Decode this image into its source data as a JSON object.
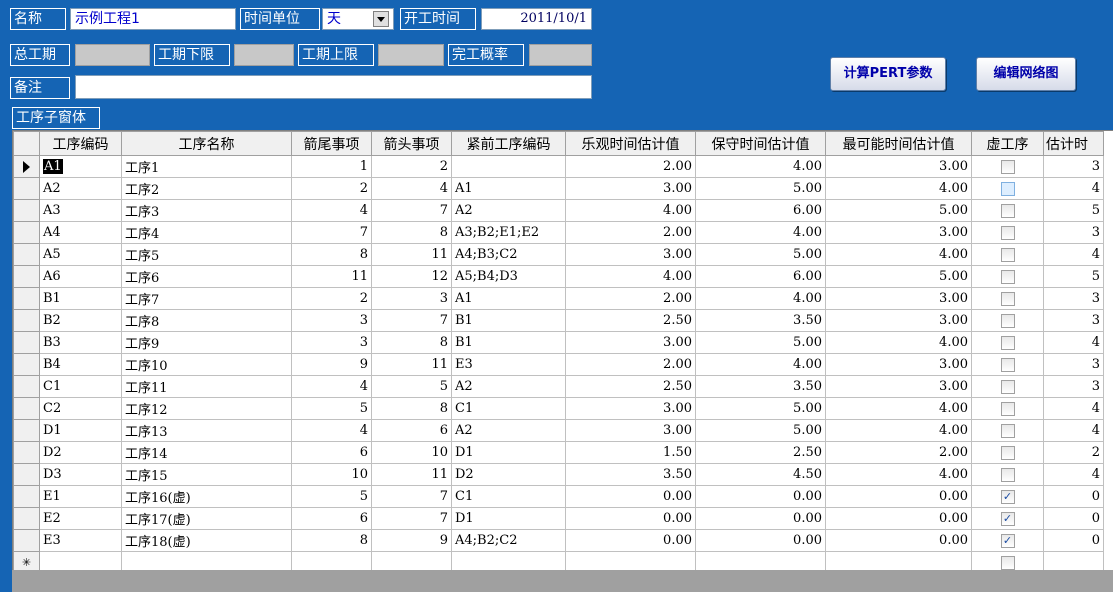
{
  "form": {
    "name_label": "名称",
    "name_value": "示例工程1",
    "time_unit_label": "时间单位",
    "time_unit_value": "天",
    "start_label": "开工时间",
    "start_value": "2011/10/1",
    "total_label": "总工期",
    "lower_label": "工期下限",
    "upper_label": "工期上限",
    "prob_label": "完工概率",
    "note_label": "备注",
    "subform_label": "工序子窗体"
  },
  "buttons": {
    "calc": "计算PERT参数",
    "edit": "编辑网络图"
  },
  "table": {
    "headers": [
      "工序编码",
      "工序名称",
      "箭尾事项",
      "箭头事项",
      "紧前工序编码",
      "乐观时间估计值",
      "保守时间估计值",
      "最可能时间估计值",
      "虚工序",
      "估计时"
    ],
    "new_row_marker": "✳",
    "rows": [
      {
        "code": "A1",
        "name": "工序1",
        "tail": "1",
        "head": "2",
        "pred": "",
        "opt": "2.00",
        "pes": "4.00",
        "likely": "3.00",
        "dummy": false,
        "est": "3"
      },
      {
        "code": "A2",
        "name": "工序2",
        "tail": "2",
        "head": "4",
        "pred": "A1",
        "opt": "3.00",
        "pes": "5.00",
        "likely": "4.00",
        "dummy": false,
        "est": "4"
      },
      {
        "code": "A3",
        "name": "工序3",
        "tail": "4",
        "head": "7",
        "pred": "A2",
        "opt": "4.00",
        "pes": "6.00",
        "likely": "5.00",
        "dummy": false,
        "est": "5"
      },
      {
        "code": "A4",
        "name": "工序4",
        "tail": "7",
        "head": "8",
        "pred": "A3;B2;E1;E2",
        "opt": "2.00",
        "pes": "4.00",
        "likely": "3.00",
        "dummy": false,
        "est": "3"
      },
      {
        "code": "A5",
        "name": "工序5",
        "tail": "8",
        "head": "11",
        "pred": "A4;B3;C2",
        "opt": "3.00",
        "pes": "5.00",
        "likely": "4.00",
        "dummy": false,
        "est": "4"
      },
      {
        "code": "A6",
        "name": "工序6",
        "tail": "11",
        "head": "12",
        "pred": "A5;B4;D3",
        "opt": "4.00",
        "pes": "6.00",
        "likely": "5.00",
        "dummy": false,
        "est": "5"
      },
      {
        "code": "B1",
        "name": "工序7",
        "tail": "2",
        "head": "3",
        "pred": "A1",
        "opt": "2.00",
        "pes": "4.00",
        "likely": "3.00",
        "dummy": false,
        "est": "3"
      },
      {
        "code": "B2",
        "name": "工序8",
        "tail": "3",
        "head": "7",
        "pred": "B1",
        "opt": "2.50",
        "pes": "3.50",
        "likely": "3.00",
        "dummy": false,
        "est": "3"
      },
      {
        "code": "B3",
        "name": "工序9",
        "tail": "3",
        "head": "8",
        "pred": "B1",
        "opt": "3.00",
        "pes": "5.00",
        "likely": "4.00",
        "dummy": false,
        "est": "4"
      },
      {
        "code": "B4",
        "name": "工序10",
        "tail": "9",
        "head": "11",
        "pred": "E3",
        "opt": "2.00",
        "pes": "4.00",
        "likely": "3.00",
        "dummy": false,
        "est": "3"
      },
      {
        "code": "C1",
        "name": "工序11",
        "tail": "4",
        "head": "5",
        "pred": "A2",
        "opt": "2.50",
        "pes": "3.50",
        "likely": "3.00",
        "dummy": false,
        "est": "3"
      },
      {
        "code": "C2",
        "name": "工序12",
        "tail": "5",
        "head": "8",
        "pred": "C1",
        "opt": "3.00",
        "pes": "5.00",
        "likely": "4.00",
        "dummy": false,
        "est": "4"
      },
      {
        "code": "D1",
        "name": "工序13",
        "tail": "4",
        "head": "6",
        "pred": "A2",
        "opt": "3.00",
        "pes": "5.00",
        "likely": "4.00",
        "dummy": false,
        "est": "4"
      },
      {
        "code": "D2",
        "name": "工序14",
        "tail": "6",
        "head": "10",
        "pred": "D1",
        "opt": "1.50",
        "pes": "2.50",
        "likely": "2.00",
        "dummy": false,
        "est": "2"
      },
      {
        "code": "D3",
        "name": "工序15",
        "tail": "10",
        "head": "11",
        "pred": "D2",
        "opt": "3.50",
        "pes": "4.50",
        "likely": "4.00",
        "dummy": false,
        "est": "4"
      },
      {
        "code": "E1",
        "name": "工序16(虚)",
        "tail": "5",
        "head": "7",
        "pred": "C1",
        "opt": "0.00",
        "pes": "0.00",
        "likely": "0.00",
        "dummy": true,
        "est": "0"
      },
      {
        "code": "E2",
        "name": "工序17(虚)",
        "tail": "6",
        "head": "7",
        "pred": "D1",
        "opt": "0.00",
        "pes": "0.00",
        "likely": "0.00",
        "dummy": true,
        "est": "0"
      },
      {
        "code": "E3",
        "name": "工序18(虚)",
        "tail": "8",
        "head": "9",
        "pred": "A4;B2;C2",
        "opt": "0.00",
        "pes": "0.00",
        "likely": "0.00",
        "dummy": true,
        "est": "0"
      }
    ]
  }
}
